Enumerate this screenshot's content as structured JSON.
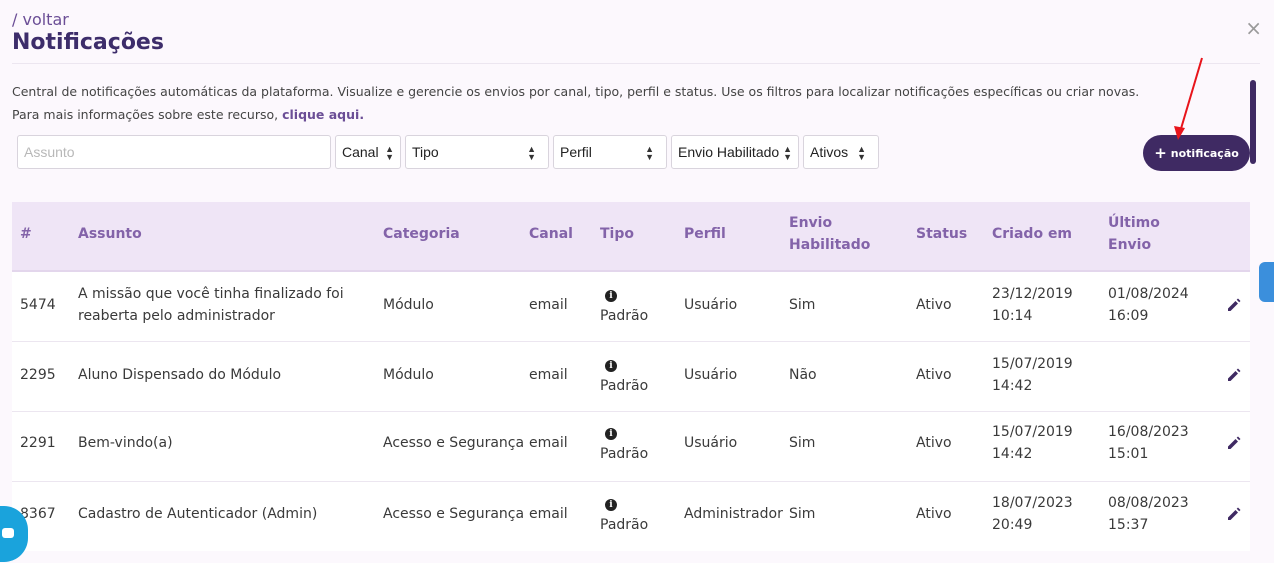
{
  "header": {
    "breadcrumb": "/ voltar",
    "title": "Notificações",
    "close_label": "×"
  },
  "description": {
    "line1": "Central de notificações automáticas da plataforma. Visualize e gerencie os envios por canal, tipo, perfil e status. Use os filtros para localizar notificações específicas ou criar novas.",
    "line2_prefix": "Para mais informações sobre este recurso, ",
    "line2_link": "clique aqui."
  },
  "filters": {
    "search_placeholder": "Assunto",
    "canal": "Canal",
    "tipo": "Tipo",
    "perfil": "Perfil",
    "envio": "Envio Habilitado",
    "status": "Ativos"
  },
  "new_button": {
    "plus": "+",
    "label": "notificação"
  },
  "table": {
    "headers": {
      "id": "#",
      "assunto": "Assunto",
      "categoria": "Categoria",
      "canal": "Canal",
      "tipo": "Tipo",
      "perfil": "Perfil",
      "envio_1": "Envio",
      "envio_2": "Habilitado",
      "status": "Status",
      "criado": "Criado em",
      "ultimo_1": "Último",
      "ultimo_2": "Envio"
    },
    "rows": [
      {
        "id": "5474",
        "assunto_1": "A missão que você tinha finalizado foi",
        "assunto_2": "reaberta pelo administrador",
        "categoria": "Módulo",
        "canal": "email",
        "tipo": "Padrão",
        "perfil": "Usuário",
        "envio": "Sim",
        "status": "Ativo",
        "criado_1": "23/12/2019",
        "criado_2": "10:14",
        "ultimo_1": "01/08/2024",
        "ultimo_2": "16:09"
      },
      {
        "id": "2295",
        "assunto_1": "Aluno Dispensado do Módulo",
        "assunto_2": "",
        "categoria": "Módulo",
        "canal": "email",
        "tipo": "Padrão",
        "perfil": "Usuário",
        "envio": "Não",
        "status": "Ativo",
        "criado_1": "15/07/2019",
        "criado_2": "14:42",
        "ultimo_1": "",
        "ultimo_2": ""
      },
      {
        "id": "2291",
        "assunto_1": "Bem-vindo(a)",
        "assunto_2": "",
        "categoria": "Acesso e Segurança",
        "canal": "email",
        "tipo": "Padrão",
        "perfil": "Usuário",
        "envio": "Sim",
        "status": "Ativo",
        "criado_1": "15/07/2019",
        "criado_2": "14:42",
        "ultimo_1": "16/08/2023",
        "ultimo_2": "15:01"
      },
      {
        "id": "8367",
        "assunto_1": "Cadastro de Autenticador (Admin)",
        "assunto_2": "",
        "categoria": "Acesso e Segurança",
        "canal": "email",
        "tipo": "Padrão",
        "perfil": "Administrador",
        "envio": "Sim",
        "status": "Ativo",
        "criado_1": "18/07/2023",
        "criado_2": "20:49",
        "ultimo_1": "08/08/2023",
        "ultimo_2": "15:37"
      }
    ]
  },
  "colors": {
    "primary": "#3f2a63",
    "header_bg": "#efe5f6",
    "header_text": "#8363a9",
    "annotation_arrow": "#e8141b"
  }
}
